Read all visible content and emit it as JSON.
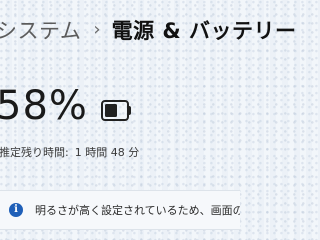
{
  "breadcrumb": {
    "parent": "システム",
    "separator": "›",
    "current": "電源 & バッテリー"
  },
  "battery": {
    "percent_text": "58%",
    "level": 0.58,
    "remaining_label": "推定残り時間:",
    "remaining_value": "1 時間 48 分"
  },
  "notice": {
    "icon": "info-icon",
    "text": "明るさが高く設定されているため、画面のバッテリー"
  },
  "colors": {
    "info_accent": "#1f5fb8",
    "battery_fill": "#202020"
  }
}
